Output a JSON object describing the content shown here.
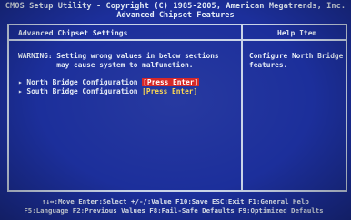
{
  "header": {
    "title_line1": "CMOS Setup Utility - Copyright (C) 1985-2005, American Megatrends, Inc.",
    "title_line2": "Advanced Chipset Features"
  },
  "left_panel": {
    "title": "Advanced Chipset Settings",
    "warning_line1": "WARNING: Setting wrong values in below sections",
    "warning_line2": "         may cause system to malfunction.",
    "items": [
      {
        "marker": "▸",
        "label": "North Bridge Configuration",
        "action": "[Press Enter]",
        "selected": true
      },
      {
        "marker": "▸",
        "label": "South Bridge Configuration",
        "action": "[Press Enter]",
        "selected": false
      }
    ]
  },
  "right_panel": {
    "title": "Help Item",
    "help_text": "Configure North Bridge features."
  },
  "footer": {
    "line1": "↑↓↔:Move  Enter:Select  +/-/:Value  F10:Save  ESC:Exit  F1:General Help",
    "line2": "F5:Language  F2:Previous Values  F8:Fail-Safe Defaults  F9:Optimized Defaults"
  },
  "colors": {
    "background": "#1c2f9b",
    "text": "#e6edf7",
    "highlight_bg": "#d42020",
    "action_text": "#ffd84a"
  }
}
